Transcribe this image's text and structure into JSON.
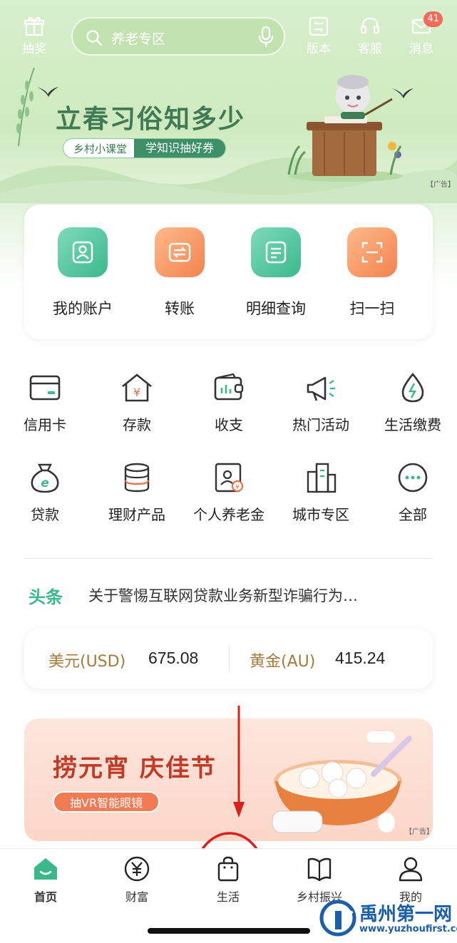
{
  "top_bar": {
    "lottery_label": "抽奖",
    "search_placeholder": "养老专区",
    "version_label": "版本",
    "service_label": "客服",
    "message_label": "消息",
    "message_badge": "41"
  },
  "banner": {
    "title": "立春习俗知多少",
    "tag_left": "乡村小课堂",
    "tag_right": "学知识抽好券",
    "ad_label": "【广告】"
  },
  "main_shortcuts": [
    {
      "label": "我的账户",
      "icon": "account-icon"
    },
    {
      "label": "转账",
      "icon": "transfer-icon"
    },
    {
      "label": "明细查询",
      "icon": "details-icon"
    },
    {
      "label": "扫一扫",
      "icon": "scan-icon"
    }
  ],
  "grid": [
    {
      "label": "信用卡",
      "icon": "credit-card-icon"
    },
    {
      "label": "存款",
      "icon": "deposit-icon"
    },
    {
      "label": "收支",
      "icon": "wallet-icon"
    },
    {
      "label": "热门活动",
      "icon": "megaphone-icon"
    },
    {
      "label": "生活缴费",
      "icon": "drop-bolt-icon"
    },
    {
      "label": "贷款",
      "icon": "money-bag-icon"
    },
    {
      "label": "理财产品",
      "icon": "coins-icon"
    },
    {
      "label": "个人养老金",
      "icon": "pension-icon"
    },
    {
      "label": "城市专区",
      "icon": "city-icon"
    },
    {
      "label": "全部",
      "icon": "more-icon"
    }
  ],
  "news": {
    "tag": "头条",
    "text": "关于警惕互联网贷款业务新型诈骗行为…"
  },
  "rates": [
    {
      "name": "美元(USD)",
      "value": "675.08"
    },
    {
      "name": "黄金(AU)",
      "value": "415.24"
    }
  ],
  "promo": {
    "title": "捞元宵 庆佳节",
    "button": "抽VR智能眼镜",
    "ad_label": "【广告】"
  },
  "bottom_nav": [
    {
      "label": "首页",
      "icon": "home-icon",
      "active": true
    },
    {
      "label": "财富",
      "icon": "yen-icon",
      "active": false
    },
    {
      "label": "生活",
      "icon": "shopping-bag-icon",
      "active": false
    },
    {
      "label": "乡村振兴",
      "icon": "book-icon",
      "active": false
    },
    {
      "label": "我的",
      "icon": "user-icon",
      "active": false
    }
  ],
  "watermark": {
    "name": "禹州第一网",
    "url": "www.yuzhoufirst.com"
  },
  "colors": {
    "accent_green": "#3bb98d",
    "accent_orange": "#f2834f",
    "annotation_red": "#d9211e"
  }
}
